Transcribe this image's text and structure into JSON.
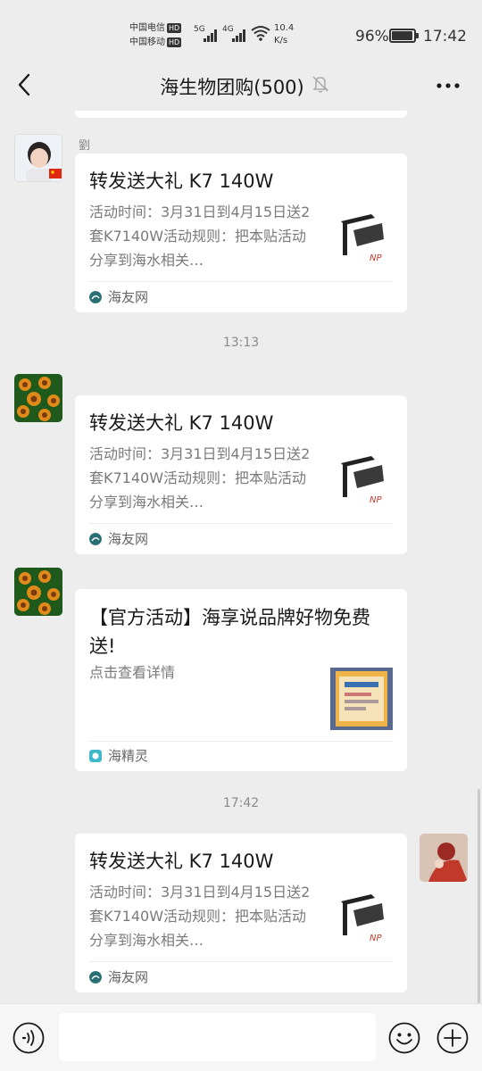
{
  "status_bar": {
    "carrier1": "中国电信",
    "carrier2": "中国移动",
    "hd": "HD",
    "net1": "5G",
    "net2": "4G",
    "speed_value": "10.4",
    "speed_unit": "K/s",
    "battery_pct": "96%",
    "battery_level": 0.96,
    "time": "17:42"
  },
  "nav": {
    "title": "海生物团购(500)",
    "icons": {
      "back": "chevron-left-icon",
      "mute": "bell-off-icon",
      "more": "more-dots-icon"
    }
  },
  "messages": [
    {
      "sender": "劉",
      "card": {
        "title": "转发送大礼 K7 140W",
        "desc": "活动时间：3月31日到4月15日送2套K7140W活动规则：把本贴活动分享到海水相关…",
        "source": "海友网",
        "thumb_brand": "NP"
      }
    },
    {
      "timestamp": "13:13"
    },
    {
      "card": {
        "title": "转发送大礼 K7 140W",
        "desc": "活动时间：3月31日到4月15日送2套K7140W活动规则：把本贴活动分享到海水相关…",
        "source": "海友网",
        "thumb_brand": "NP"
      }
    },
    {
      "card": {
        "title": "【官方活动】海享说品牌好物免费送!",
        "desc": "点击查看详情",
        "source": "海精灵"
      }
    },
    {
      "timestamp": "17:42"
    },
    {
      "card": {
        "title": "转发送大礼 K7 140W",
        "desc": "活动时间：3月31日到4月15日送2套K7140W活动规则：把本贴活动分享到海水相关…",
        "source": "海友网",
        "thumb_brand": "NP"
      }
    }
  ],
  "input_bar": {
    "placeholder": "",
    "icons": {
      "voice": "voice-icon",
      "emoji": "emoji-icon",
      "plus": "plus-icon"
    }
  },
  "colors": {
    "background": "#ededed",
    "card": "#ffffff",
    "haiyouwang_icon": "#2a6f75",
    "haijingling_icon": "#3fb8c9"
  }
}
